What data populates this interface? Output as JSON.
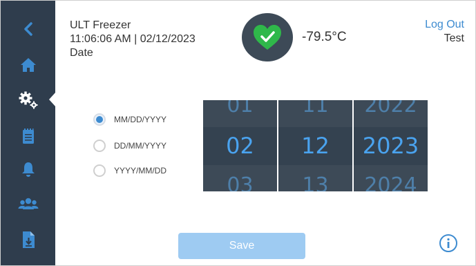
{
  "header": {
    "app_name": "ULT Freezer",
    "time_date": "11:06:06 AM | 02/12/2023",
    "page_title": "Date",
    "temperature": "-79.5°C",
    "logout_label": "Log Out",
    "user_name": "Test",
    "status_icon": "heart-check-icon"
  },
  "sidebar": {
    "items": [
      {
        "icon": "back-arrow-icon",
        "active": false
      },
      {
        "icon": "home-icon",
        "active": false
      },
      {
        "icon": "settings-gears-icon",
        "active": true
      },
      {
        "icon": "notepad-icon",
        "active": false
      },
      {
        "icon": "bell-icon",
        "active": false
      },
      {
        "icon": "users-icon",
        "active": false
      },
      {
        "icon": "file-export-icon",
        "active": false
      }
    ]
  },
  "date_format": {
    "options": [
      {
        "label": "MM/DD/YYYY",
        "selected": true
      },
      {
        "label": "DD/MM/YYYY",
        "selected": false
      },
      {
        "label": "YYYY/MM/DD",
        "selected": false
      }
    ]
  },
  "picker": {
    "month": {
      "prev": "01",
      "selected": "02",
      "next": "03"
    },
    "day": {
      "prev": "11",
      "selected": "12",
      "next": "13"
    },
    "year": {
      "prev": "2022",
      "selected": "2023",
      "next": "2024"
    }
  },
  "footer": {
    "save_label": "Save",
    "info_icon": "info-icon"
  },
  "colors": {
    "sidebar_bg": "#2f3d4d",
    "accent": "#3d8bd0",
    "status_green": "#2fb84a",
    "picker_bg": "#3d4a57",
    "save_disabled": "#9ecbf2"
  }
}
